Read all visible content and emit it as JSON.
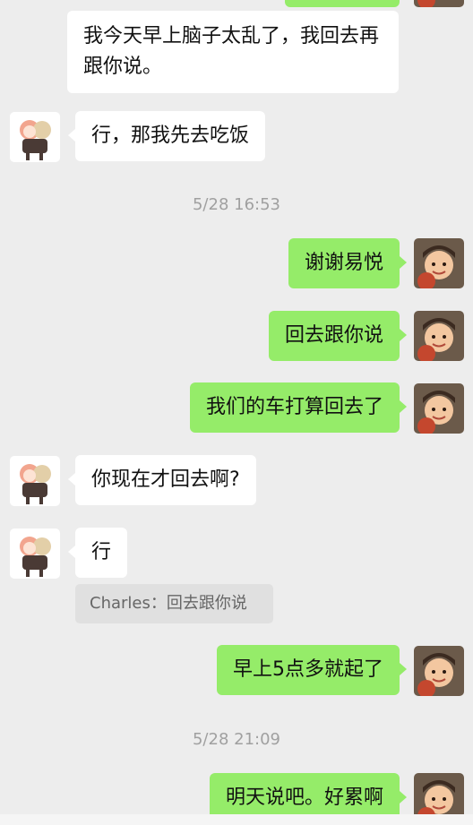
{
  "messages": {
    "m1": "我今天早上脑子太乱了，我回去再跟你说。",
    "m2": "行，那我先去吃饭",
    "m3": "谢谢易悦",
    "m4": "回去跟你说",
    "m5": "我们的车打算回去了",
    "m6": "你现在才回去啊?",
    "m7": "行",
    "m8": "早上5点多就起了",
    "m9": "明天说吧。好累啊"
  },
  "quote": "Charles：回去跟你说",
  "timestamps": {
    "t1": "5/28 16:53",
    "t2": "5/28 21:09"
  },
  "colors": {
    "background": "#ededed",
    "outgoing_bubble": "#95ec69",
    "incoming_bubble": "#ffffff"
  },
  "avatars": {
    "incoming": "anime-girl-avatar",
    "outgoing": "boy-photo-avatar"
  }
}
